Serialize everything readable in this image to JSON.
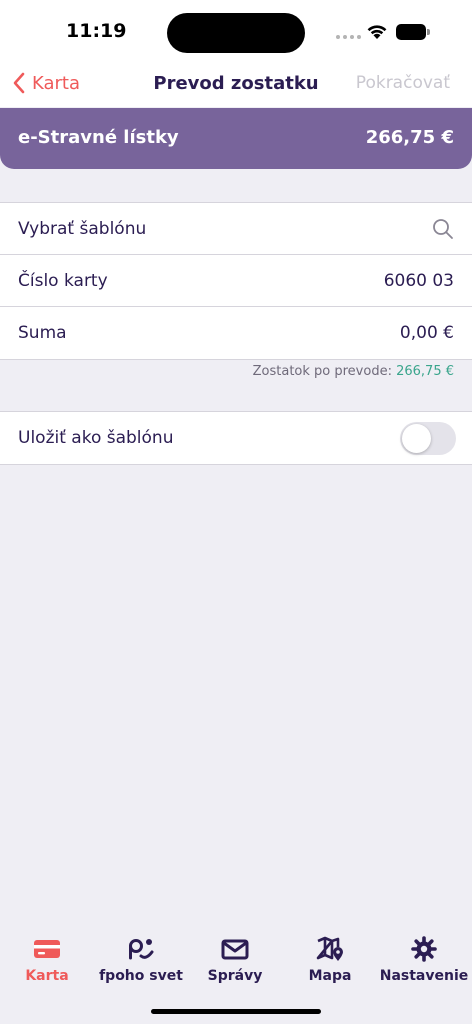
{
  "status_bar": {
    "time": "11:19"
  },
  "nav": {
    "back_label": "Karta",
    "title": "Prevod zostatku",
    "continue_label": "Pokračovať"
  },
  "card": {
    "name": "e-Stravné lístky",
    "balance": "266,75 €"
  },
  "form": {
    "template_label": "Vybrať šablónu",
    "card_number_label": "Číslo karty",
    "card_number_value": "6060 03",
    "amount_label": "Suma",
    "amount_value": "0,00 €",
    "remaining_label": "Zostatok po prevode:",
    "remaining_value": "266,75 €",
    "save_template_label": "Uložiť ako šablónu",
    "save_template_on": false
  },
  "tabs": [
    {
      "label": "Karta",
      "icon": "card-icon",
      "active": true
    },
    {
      "label": "fpoho svet",
      "icon": "fpoho-icon",
      "active": false
    },
    {
      "label": "Správy",
      "icon": "mail-icon",
      "active": false
    },
    {
      "label": "Mapa",
      "icon": "map-icon",
      "active": false
    },
    {
      "label": "Nastavenie",
      "icon": "gear-icon",
      "active": false
    }
  ],
  "colors": {
    "accent": "#ef5a5a",
    "card_banner": "#78649b",
    "text": "#2b1d52",
    "remaining": "#3aa58c"
  }
}
